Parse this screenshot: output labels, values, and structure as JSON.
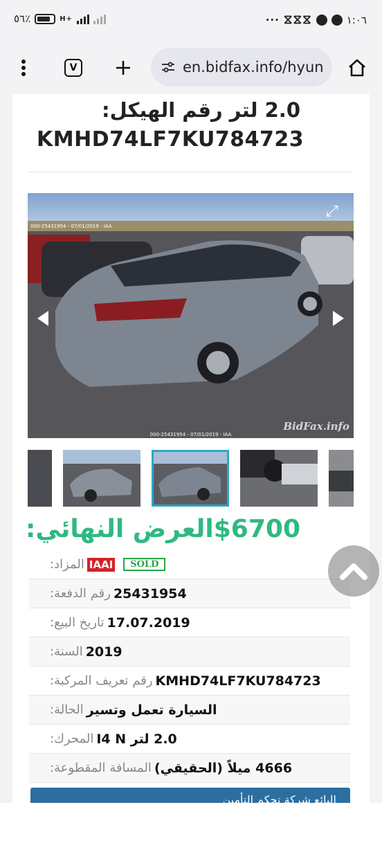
{
  "statusbar": {
    "battery": "٥٦٪",
    "network": "H+",
    "time": "١:٠٦"
  },
  "browser": {
    "url": "en.bidfax.info/hyun",
    "tab_count": "V"
  },
  "listing": {
    "title_line1": "2.0 لتر رقم الهيكل:",
    "title_line2": "KMHD74LF7KU784723",
    "photo_caption_top": "000-25431954 - 07/01/2019 - IAA",
    "photo_caption_bottom": "000-25431954 - 07/01/2019 - IAA",
    "watermark": "BidFax.info",
    "price_value": "$6700",
    "price_label": "العرض النهائي:",
    "rows": [
      {
        "label": "المزاد:",
        "value": "",
        "badges": [
          "IAAI",
          "SOLD"
        ]
      },
      {
        "label": "رقم الدفعة:",
        "value": "25431954"
      },
      {
        "label": "تاريخ البيع:",
        "value": "17.07.2019"
      },
      {
        "label": "السنة:",
        "value": "2019"
      },
      {
        "label": "رقم تعريف المركبة:",
        "value": "KMHD74LF7KU784723"
      },
      {
        "label": "الحالة:",
        "value": "السيارة تعمل وتسير"
      },
      {
        "label": "المحرك:",
        "value": "2.0 لتر I4 N"
      },
      {
        "label": "المسافة المقطوعة:",
        "value": "4666 ميلاً (الحقيقي)"
      }
    ],
    "bottom_button": "البائع شركة تحكم التأمين"
  },
  "colors": {
    "price": "#2fb982",
    "iaai": "#d62027",
    "sold": "#28a745",
    "active_thumb": "#2ca7c9",
    "button": "#2d6ea0"
  }
}
